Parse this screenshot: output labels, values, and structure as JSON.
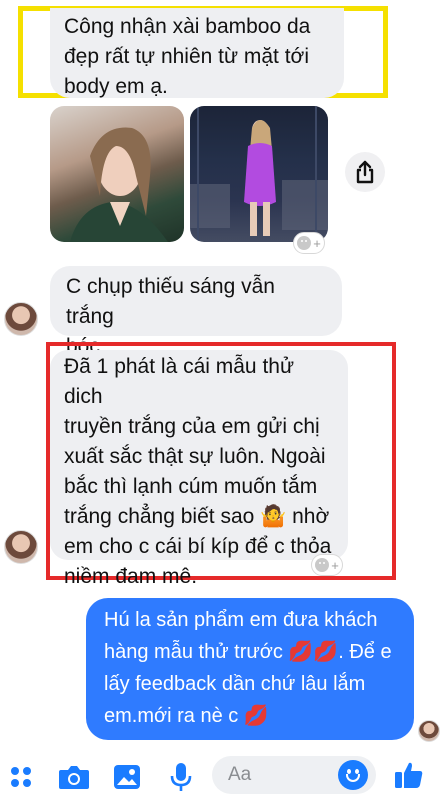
{
  "messages": {
    "msg1": {
      "lines": [
        "Công nhận xài bamboo da",
        "đẹp rất tự nhiên từ mặt tới",
        "body em ạ."
      ]
    },
    "photo_message": {
      "photos": [
        "photo-selfie-green-shirt",
        "photo-purple-dress"
      ]
    },
    "msg2": {
      "lines": [
        "C chụp thiếu sáng vẫn trắng",
        "bóc."
      ]
    },
    "msg3": {
      "lines": [
        "Đã 1 phát là cái mẫu thử dich",
        "truyền trắng của em gửi chị",
        "xuất sắc thật sự luôn. Ngoài",
        "bắc thì lạnh cúm muốn tắm",
        "trắng chẳng biết sao 🤷 nhờ",
        "em cho c cái bí kíp để c thỏa",
        "niềm đam mê."
      ]
    },
    "msg4": {
      "lines": [
        "Hú la sản phẩm em đưa khách",
        "hàng mẫu thử trước 💋💋. Để e",
        "lấy feedback dần chứ lâu lắm",
        "em.mới ra nè c 💋"
      ]
    }
  },
  "composer": {
    "placeholder": "Aa"
  },
  "icons": {
    "share": "share-icon",
    "apps": "grid-dots-icon",
    "camera": "camera-icon",
    "gallery": "image-icon",
    "mic": "microphone-icon",
    "emoji": "emoji-icon",
    "like": "thumbs-up-icon"
  },
  "colors": {
    "outgoing_bubble": "#2f7bff",
    "incoming_bubble": "#eeeff2",
    "accent": "#1a7cff",
    "highlight_yellow": "#f5e000",
    "highlight_red": "#e52a2a"
  }
}
